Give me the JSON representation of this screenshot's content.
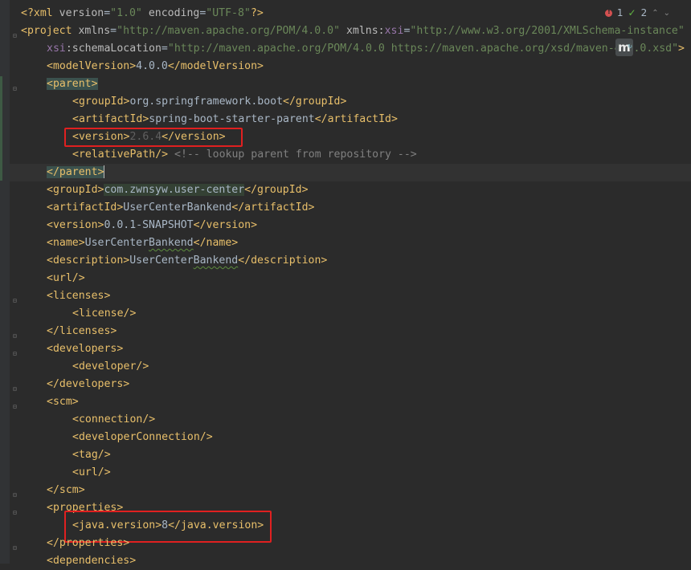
{
  "status": {
    "errors": "1",
    "warnings": "2"
  },
  "maven_badge": "m",
  "lines": {
    "l0": {
      "open": "<?xml ",
      "a1": "version",
      "eq1": "=",
      "v1": "\"1.0\"",
      "a2": " encoding",
      "eq2": "=",
      "v2": "\"UTF-8\"",
      "close": "?>"
    },
    "l1": {
      "open": "<project ",
      "a1": "xmlns",
      "eq1": "=",
      "v1": "\"http://maven.apache.org/POM/4.0.0\"",
      "a2": " xmlns",
      "colon": ":",
      "ns": "xsi",
      "eq2": "=",
      "v2": "\"http://www.w3.org/2001/XMLSchema-instance\""
    },
    "l2": {
      "ns": "xsi",
      "a1": ":schemaLocation",
      "eq": "=",
      "v1": "\"http://maven.apache.org/POM/4.0.0 https://maven.apache.org/xsd/maven-4.0.0.xsd\"",
      "close": ">"
    },
    "l3": {
      "o": "<modelVersion>",
      "t": "4.0.0",
      "c": "</modelVersion>"
    },
    "l4": {
      "o": "<parent>"
    },
    "l5": {
      "o": "<groupId>",
      "t": "org.springframework.boot",
      "c": "</groupId>"
    },
    "l6": {
      "o": "<artifactId>",
      "t": "spring-boot-starter-parent",
      "c": "</artifactId>"
    },
    "l7": {
      "o": "<version>",
      "t": "2.6.4",
      "c": "</version>"
    },
    "l8": {
      "o": "<relativePath/>",
      "cmt": " <!-- lookup parent from repository -->"
    },
    "l9": {
      "c": "</parent>"
    },
    "l10": {
      "o": "<groupId>",
      "t": "com.zwnsyw.user-center",
      "c": "</groupId>"
    },
    "l11": {
      "o": "<artifactId>",
      "t": "UserCenterBankend",
      "c": "</artifactId>"
    },
    "l12": {
      "o": "<version>",
      "t": "0.0.1-SNAPSHOT",
      "c": "</version>"
    },
    "l13": {
      "o": "<name>",
      "t1": "UserCenter",
      "t2": "Bankend",
      "c": "</name>"
    },
    "l14": {
      "o": "<description>",
      "t1": "UserCenter",
      "t2": "Bankend",
      "c": "</description>"
    },
    "l15": {
      "o": "<url/>"
    },
    "l16": {
      "o": "<licenses>"
    },
    "l17": {
      "o": "<license/>"
    },
    "l18": {
      "c": "</licenses>"
    },
    "l19": {
      "o": "<developers>"
    },
    "l20": {
      "o": "<developer/>"
    },
    "l21": {
      "c": "</developers>"
    },
    "l22": {
      "o": "<scm>"
    },
    "l23": {
      "o": "<connection/>"
    },
    "l24": {
      "o": "<developerConnection/>"
    },
    "l25": {
      "o": "<tag/>"
    },
    "l26": {
      "o": "<url/>"
    },
    "l27": {
      "c": "</scm>"
    },
    "l28": {
      "o": "<properties>"
    },
    "l29": {
      "o": "<java.version>",
      "t": "8",
      "c": "</java.version>"
    },
    "l30": {
      "c": "</properties>"
    },
    "l31": {
      "o": "<dependencies>"
    }
  },
  "colors": {
    "background": "#2b2b2b",
    "tag": "#e8bf6a",
    "string": "#6a8759",
    "highlight_box": "#e02020"
  }
}
